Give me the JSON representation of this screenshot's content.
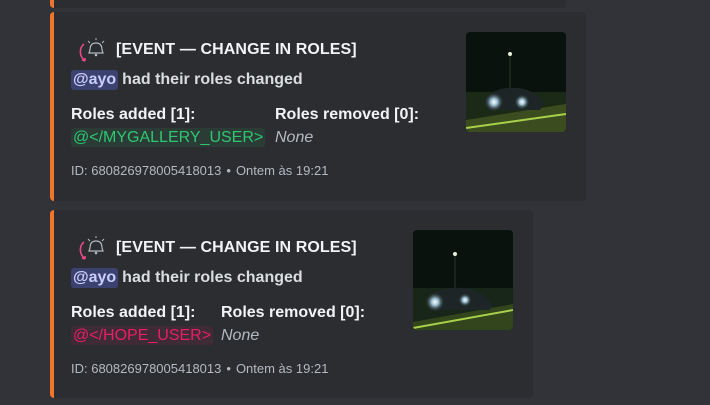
{
  "messages": [
    {
      "author": "[EVENT — CHANGE IN ROLES]",
      "mention": "@ayo",
      "description": "had their roles changed",
      "fields": [
        {
          "name": "Roles added [1]:",
          "value": "@</MYGALLERY_USER>"
        },
        {
          "name": "Roles removed [0]:",
          "value": "None"
        }
      ],
      "footer_id": "ID: 680826978005418013",
      "footer_time": "Ontem às 19:21",
      "role_color": "#2dc770"
    },
    {
      "author": "[EVENT — CHANGE IN ROLES]",
      "mention": "@ayo",
      "description": "had their roles changed",
      "fields": [
        {
          "name": "Roles added [1]:",
          "value": "@</HOPE_USER>"
        },
        {
          "name": "Roles removed [0]:",
          "value": "None"
        }
      ],
      "footer_id": "ID: 680826978005418013",
      "footer_time": "Ontem às 19:21",
      "role_color": "#e91e63"
    }
  ],
  "footer_separator": "•",
  "embed_accent": "#f0752c",
  "icons": {
    "author": "bell-alert-icon",
    "thumbnail": "night-car-photo"
  }
}
